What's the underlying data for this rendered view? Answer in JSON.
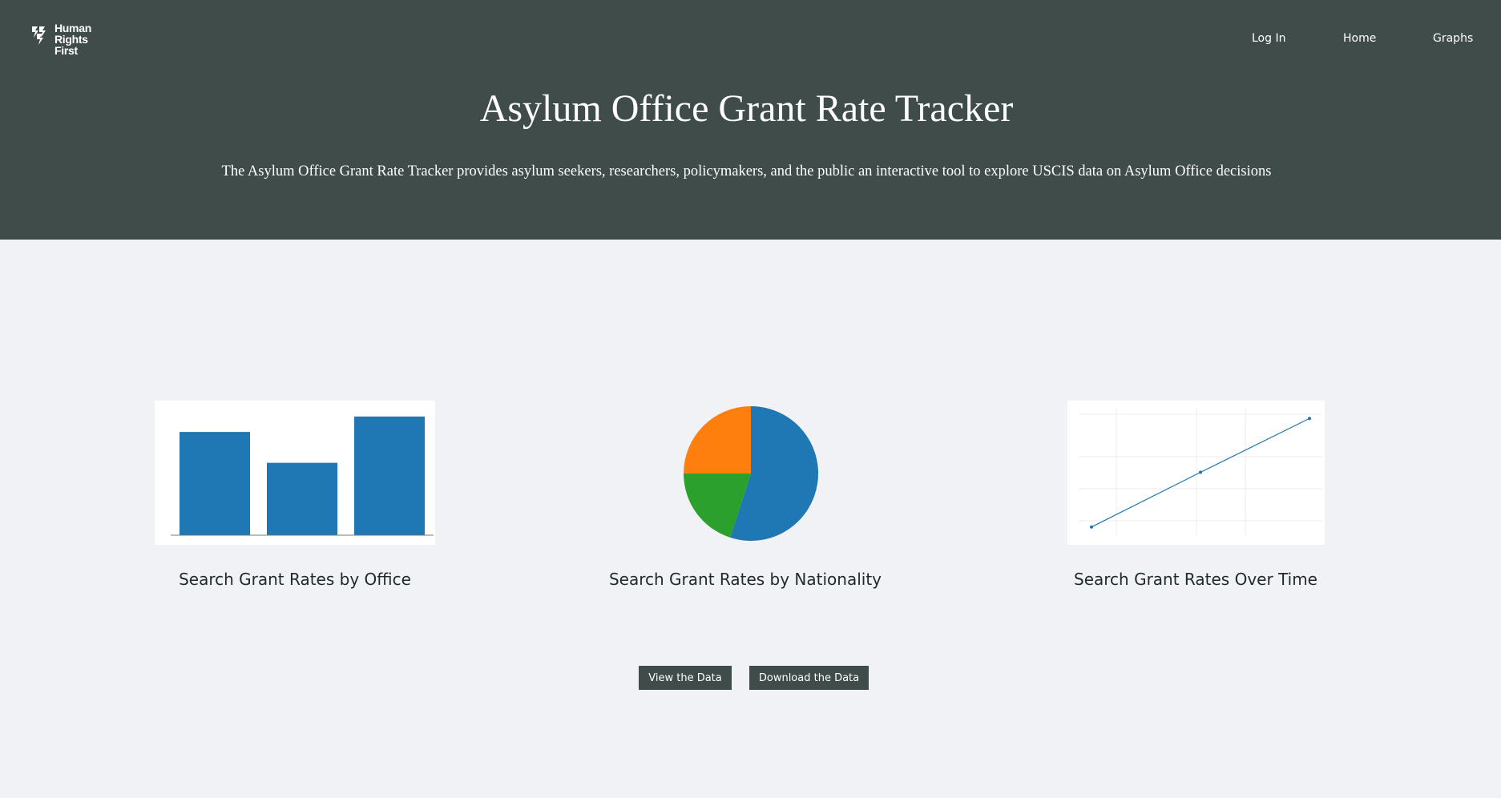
{
  "brand": {
    "logo_lines": [
      "Human",
      "Rights",
      "First"
    ]
  },
  "nav": {
    "login": "Log In",
    "home": "Home",
    "graphs": "Graphs"
  },
  "hero": {
    "title": "Asylum Office Grant Rate Tracker",
    "subtitle": "The Asylum Office Grant Rate Tracker provides asylum seekers, researchers, policymakers, and the public an interactive tool to explore USCIS data on Asylum Office decisions"
  },
  "cards": {
    "office": {
      "label": "Search Grant Rates by Office"
    },
    "nationality": {
      "label": "Search Grant Rates by Nationality"
    },
    "time": {
      "label": "Search Grant Rates Over Time"
    }
  },
  "buttons": {
    "view": "View the Data",
    "download": "Download the Data"
  },
  "colors": {
    "header_bg": "#404c4a",
    "page_bg": "#f0f2f5",
    "blue": "#1f77b4",
    "orange": "#ff7f0e",
    "green": "#2ca02c"
  },
  "chart_data": [
    {
      "type": "bar",
      "categories": [
        "",
        "",
        ""
      ],
      "values": [
        0.87,
        0.61,
        1.0
      ],
      "ylim": [
        0,
        1.08
      ],
      "grid": false
    },
    {
      "type": "pie",
      "values": [
        0.55,
        0.2,
        0.25
      ],
      "colors": [
        "#1f77b4",
        "#2ca02c",
        "#ff7f0e"
      ]
    },
    {
      "type": "line",
      "x": [
        0,
        1,
        2
      ],
      "y": [
        0,
        1.34,
        2.66
      ],
      "ylim": [
        -0.2,
        2.9
      ],
      "grid": true
    }
  ]
}
